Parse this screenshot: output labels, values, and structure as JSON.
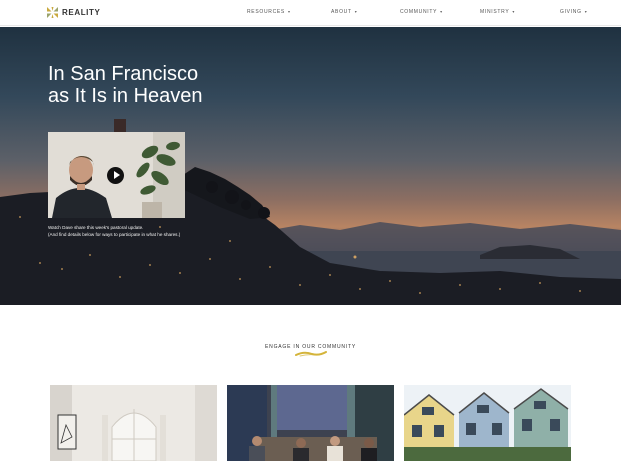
{
  "header": {
    "logo_text": "REALITY",
    "nav": [
      {
        "label": "RESOURCES"
      },
      {
        "label": "ABOUT"
      },
      {
        "label": "COMMUNITY"
      },
      {
        "label": "MINISTRY"
      },
      {
        "label": "GIVING"
      }
    ],
    "caret": "▾"
  },
  "hero": {
    "title_line1": "In San Francisco",
    "title_line2": "as It Is in Heaven",
    "caption_line1": "Watch Dave share this week's pastoral update.",
    "caption_line2": "(And find details below for ways to participate in what he shares.)"
  },
  "engage": {
    "heading": "ENGAGE IN OUR COMMUNITY",
    "accent_color": "#d4b43a"
  },
  "icons": {
    "logo": "reality-logo-icon",
    "play": "play-icon"
  }
}
